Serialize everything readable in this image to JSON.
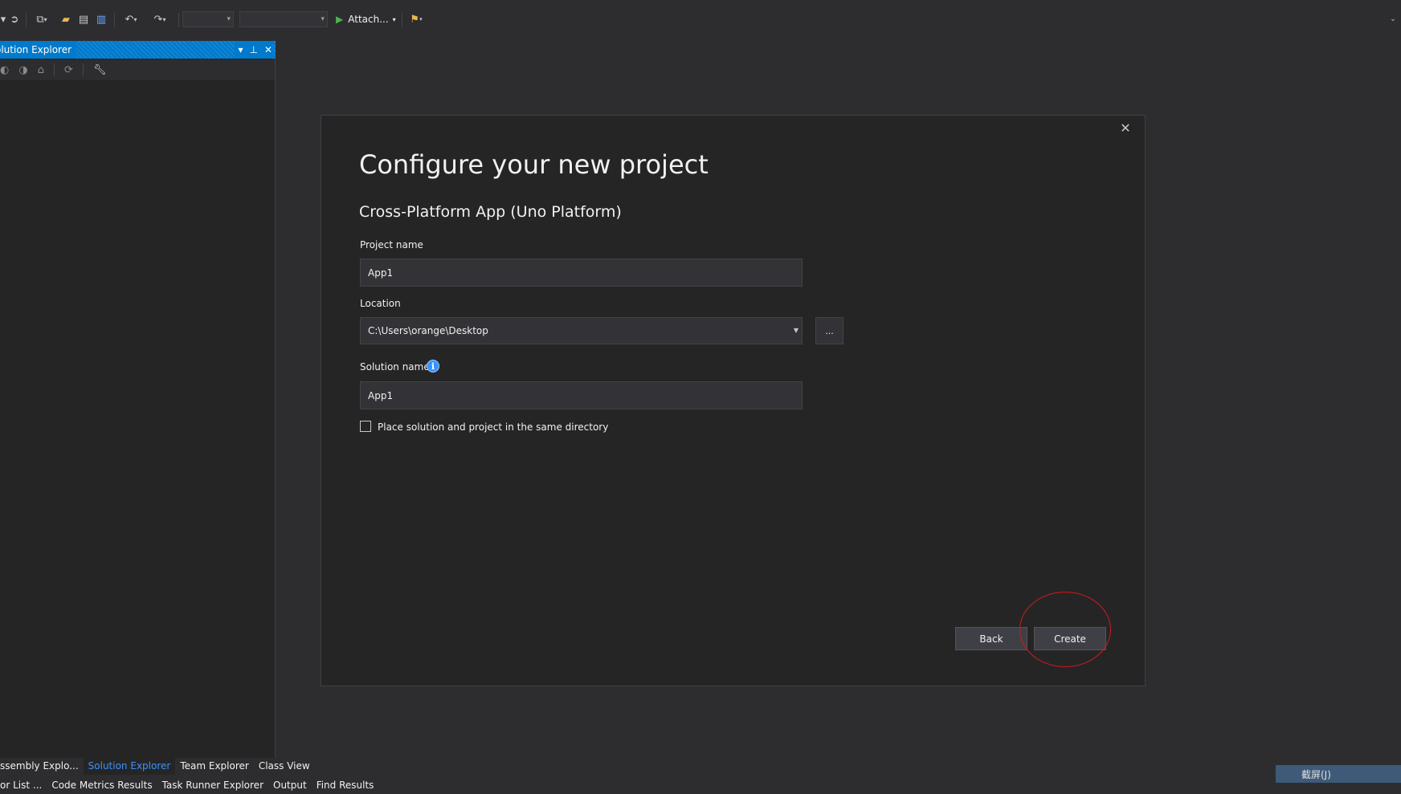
{
  "toolbar": {
    "attach_label": "Attach...",
    "icons": [
      "back-nav-icon",
      "forward-nav-icon",
      "new-project-icon",
      "open-folder-icon",
      "save-icon",
      "save-all-icon",
      "undo-icon",
      "redo-icon",
      "start-debug-icon",
      "feedback-icon"
    ]
  },
  "solution_explorer": {
    "title": "olution Explorer"
  },
  "dialog": {
    "heading": "Configure your new project",
    "template_name": "Cross-Platform App (Uno Platform)",
    "project_name": {
      "label": "Project name",
      "value": "App1"
    },
    "location": {
      "label": "Location",
      "value": "C:\\Users\\orange\\Desktop",
      "browse_label": "..."
    },
    "solution_name": {
      "label": "Solution name",
      "value": "App1"
    },
    "same_directory": {
      "label": "Place solution and project in the same directory",
      "checked": false
    },
    "back_label": "Back",
    "create_label": "Create"
  },
  "bottom_tabs": {
    "row1": [
      "ssembly Explo...",
      "Solution Explorer",
      "Team Explorer",
      "Class View"
    ],
    "row1_active": "Solution Explorer",
    "row2": [
      "or List ...",
      "Code Metrics Results",
      "Task Runner Explorer",
      "Output",
      "Find Results"
    ]
  },
  "status_chip": "截屏(J)",
  "colors": {
    "accent": "#007acc",
    "dialog_bg": "#252526",
    "ide_bg": "#2d2d30",
    "highlight_ring": "#d21a1a"
  }
}
